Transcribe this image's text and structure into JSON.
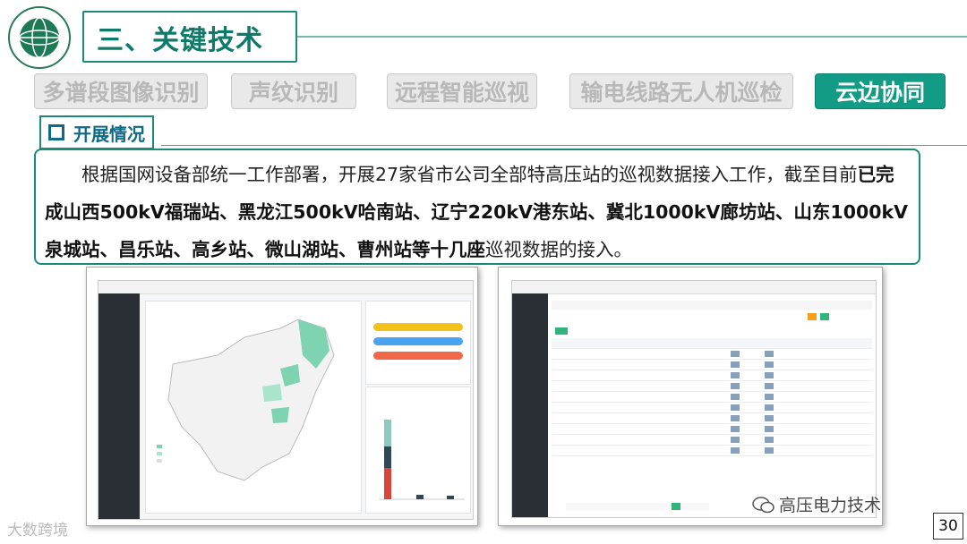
{
  "title": "三、关键技术",
  "tabs": [
    {
      "label": "多谱段图像识别",
      "active": false
    },
    {
      "label": "声纹识别",
      "active": false
    },
    {
      "label": "远程智能巡视",
      "active": false
    },
    {
      "label": "输电线路无人机巡检",
      "active": false
    },
    {
      "label": "云边协同",
      "active": true
    }
  ],
  "section_heading": "开展情况",
  "body": {
    "part1": "　　根据国网设备部统一工作部署，开展27家省市公司全部特高压站的巡视数据接入工作，截至目前",
    "part2_bold": "已完成山西500kV福瑞站、黑龙江500kV哈南站、辽宁220kV港东站、冀北1000kV廊坊站、山东1000kV泉城站、昌乐站、高乡站、微山湖站、曹州站等十几座",
    "part3": "巡视数据的接入。"
  },
  "wechat_watermark": "高压电力技术",
  "bottom_watermark": "大数跨境",
  "page_number": "30",
  "colors": {
    "accent": "#129c86",
    "heading": "#0e6a86",
    "sidebar": "#2a2f36"
  }
}
